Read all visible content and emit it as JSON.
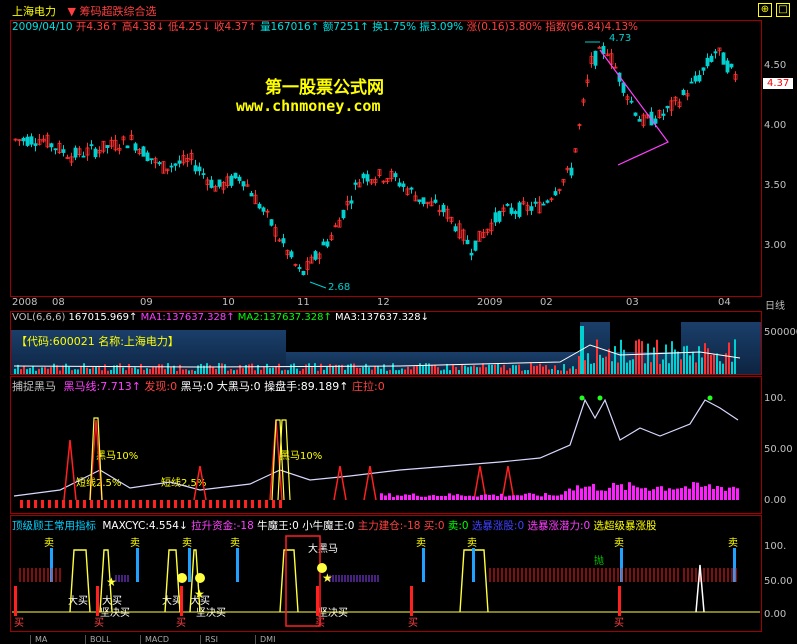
{
  "header": {
    "stock_name": "上海电力",
    "indicator_name": "筹码超跌综合选",
    "date": "2009/04/10",
    "open": "开4.36",
    "high": "高4.38",
    "low": "低4.25",
    "close": "收4.37",
    "volume": "量167016",
    "amount": "额7251",
    "turnover": "换1.75%",
    "amplitude": "振3.09%",
    "change": "涨(0.16)3.80%",
    "index": "指数(96.84)4.13%"
  },
  "watermark": {
    "line1": "第一股票公式网",
    "line2": "www.chnmoney.com"
  },
  "price_panel": {
    "high_label": "4.73",
    "low_label": "2.68",
    "current_price": "4.37",
    "y_ticks": [
      "4.50",
      "4.00",
      "3.50",
      "3.00"
    ],
    "x_labels": [
      "2008",
      "08",
      "09",
      "10",
      "11",
      "12",
      "2009",
      "02",
      "03",
      "04"
    ],
    "period": "日线"
  },
  "volume_panel": {
    "title": "VOL(6,6,6)",
    "vol": "167015.969",
    "ma1": "MA1:137637.328",
    "ma2": "MA2:137637.328",
    "ma3": "MA3:137637.328",
    "info": "【代码:600021  名称:上海电力】",
    "y_tick": "500000"
  },
  "dark_horse_panel": {
    "title": "捕捉黑马",
    "dh_line": "黑马线:7.713",
    "found": "发现:0",
    "dh": "黑马:0",
    "big_dh": "大黑马:0",
    "operator": "操盘手:89.189",
    "pull": "庄拉:0",
    "labels": [
      "黑马10%",
      "短线2.5%",
      "短线2.5%",
      "黑马10%"
    ],
    "y_ticks": [
      "100.",
      "50.00",
      "0.00"
    ]
  },
  "top_panel": {
    "title": "顶级顾王常用指标",
    "maxcyc": "MAXCYC:4.554",
    "lift": "拉升资金:-18",
    "bull": "牛魔王:0",
    "small_bull": "小牛魔王:0",
    "main_build": "主力建仓:-18",
    "buy": "买:0",
    "sell": "卖:0",
    "select1": "选暴涨股:0",
    "select2": "选暴涨潜力:0",
    "select3": "选超级暴涨股",
    "y_ticks": [
      "100.",
      "50.00",
      "0.00"
    ],
    "marks": {
      "sell": "卖",
      "buy": "买",
      "big_buy": "大买",
      "decisive": "坚决买",
      "big_dh": "大黑马",
      "throw": "抛"
    }
  },
  "tabs": [
    "MA",
    "BOLL",
    "MACD",
    "RSI",
    "DMI"
  ],
  "colors": {
    "up": "#ff3030",
    "down": "#00d0d0",
    "title": "#ffff00"
  }
}
